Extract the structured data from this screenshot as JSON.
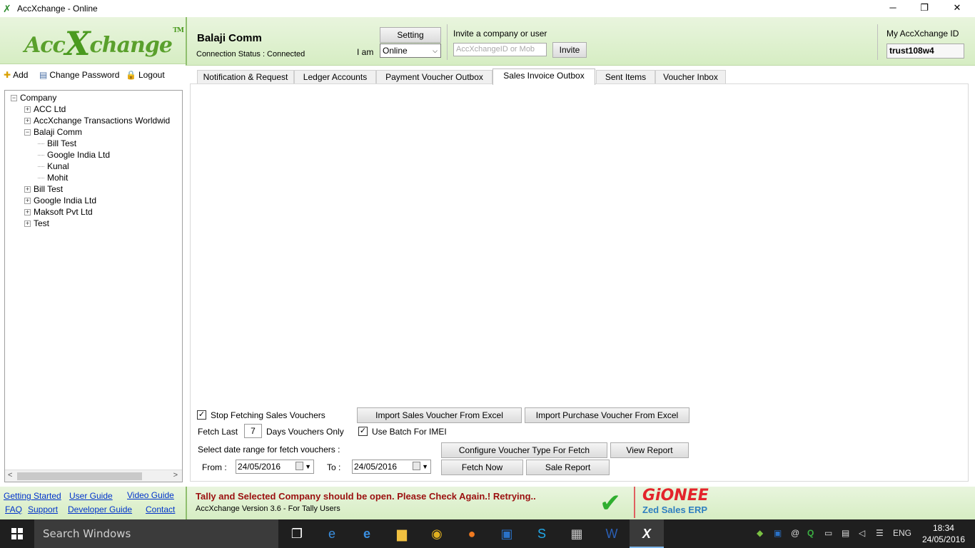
{
  "window": {
    "title": "AccXchange - Online",
    "minimize": "─",
    "maximize": "❐",
    "close": "✕"
  },
  "logo": {
    "pre": "Acc",
    "x": "X",
    "post": "change",
    "tm": "TM"
  },
  "left_toolbar": {
    "add": "Add",
    "change_password": "Change Password",
    "logout": "Logout"
  },
  "tree": {
    "root": "Company",
    "items": [
      "ACC Ltd",
      "AccXchange Transactions Worldwid",
      "Balaji Comm",
      "Bill Test",
      "Google India Ltd",
      "Kunal",
      "Mohit",
      "Bill Test",
      "Google India Ltd",
      "Maksoft Pvt Ltd",
      "Test"
    ]
  },
  "header": {
    "company_name": "Balaji Comm",
    "connection_status": "Connection Status : Connected",
    "setting_label": "Setting",
    "iam_label": "I am",
    "iam_value": "Online",
    "invite_label": "Invite a company or user",
    "invite_placeholder": "AccXchangeID or Mob",
    "invite_button": "Invite",
    "my_id_label": "My AccXchange ID",
    "my_id_value": "trust108w4"
  },
  "tabs": [
    "Notification & Request",
    "Ledger Accounts",
    "Payment Voucher Outbox",
    "Sales Invoice Outbox",
    "Sent Items",
    "Voucher Inbox"
  ],
  "active_tab": "Sales Invoice Outbox",
  "controls": {
    "stop_fetching": "Stop Fetching Sales Vouchers",
    "stop_fetching_checked": true,
    "import_sales": "Import Sales Voucher From Excel",
    "import_purchase": "Import Purchase Voucher From Excel",
    "fetch_last": "Fetch Last",
    "fetch_days": "7",
    "days_only": "Days Vouchers Only",
    "use_batch": "Use Batch For IMEI",
    "use_batch_checked": true,
    "date_range_label": "Select date range for fetch vouchers :",
    "configure": "Configure Voucher Type For Fetch",
    "view_report": "View Report",
    "from_label": "From :",
    "from_date": "24/05/2016",
    "to_label": "To :",
    "to_date": "24/05/2016",
    "fetch_now": "Fetch Now",
    "sale_report": "Sale Report"
  },
  "footer_links": {
    "getting_started": "Getting Started",
    "user_guide": "User Guide",
    "video_guide": "Video Guide",
    "faq": "FAQ",
    "support": "Support",
    "developer_guide": "Developer Guide",
    "contact": "Contact"
  },
  "status": {
    "message": "Tally and Selected Company should be open. Please Check Again.! Retrying..",
    "version": "AccXchange Version 3.6 - For Tally Users"
  },
  "brand": {
    "name": "GiONEE",
    "sub": "Zed Sales ERP"
  },
  "taskbar": {
    "search": "Search Windows",
    "lang": "ENG",
    "time": "18:34",
    "date": "24/05/2016"
  },
  "colors": {
    "accent_green": "#5aa02c",
    "status_red": "#9b1010",
    "link_blue": "#0033cc"
  }
}
